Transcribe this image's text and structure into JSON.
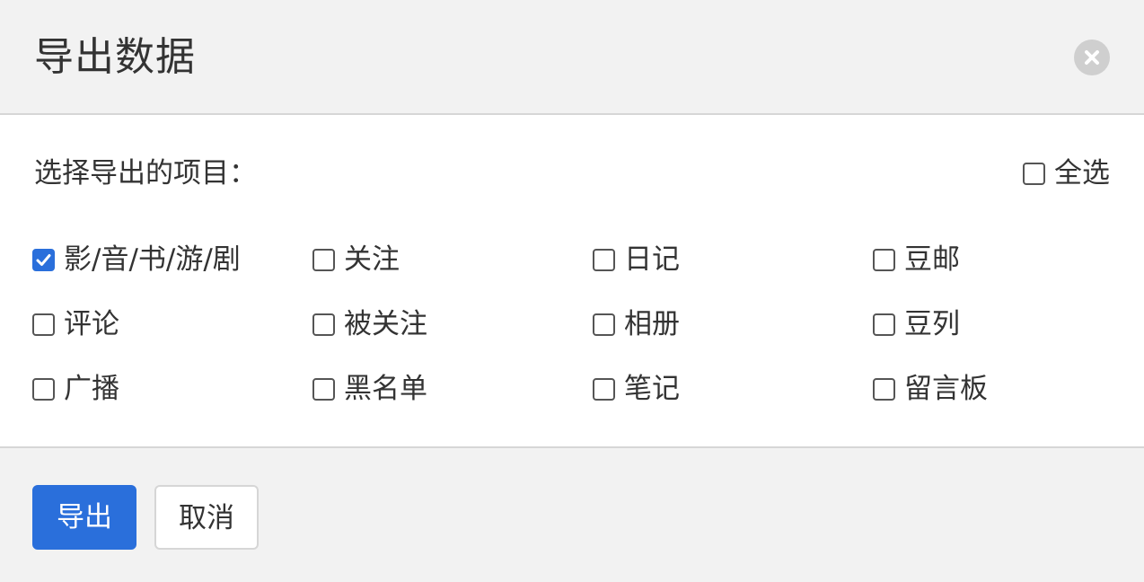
{
  "dialog": {
    "title": "导出数据",
    "close_icon": "close-icon"
  },
  "body": {
    "prompt": "选择导出的项目：",
    "select_all": {
      "label": "全选",
      "checked": false
    },
    "options": [
      {
        "label": "影/音/书/游/剧",
        "checked": true
      },
      {
        "label": "关注",
        "checked": false
      },
      {
        "label": "日记",
        "checked": false
      },
      {
        "label": "豆邮",
        "checked": false
      },
      {
        "label": "评论",
        "checked": false
      },
      {
        "label": "被关注",
        "checked": false
      },
      {
        "label": "相册",
        "checked": false
      },
      {
        "label": "豆列",
        "checked": false
      },
      {
        "label": "广播",
        "checked": false
      },
      {
        "label": "黑名单",
        "checked": false
      },
      {
        "label": "笔记",
        "checked": false
      },
      {
        "label": "留言板",
        "checked": false
      }
    ]
  },
  "footer": {
    "export_label": "导出",
    "cancel_label": "取消"
  },
  "colors": {
    "primary": "#2a6fdb",
    "panel_bg": "#f2f2f2",
    "divider": "#d6d6d6",
    "close_bg": "#cfcfcf",
    "text": "#333333"
  }
}
